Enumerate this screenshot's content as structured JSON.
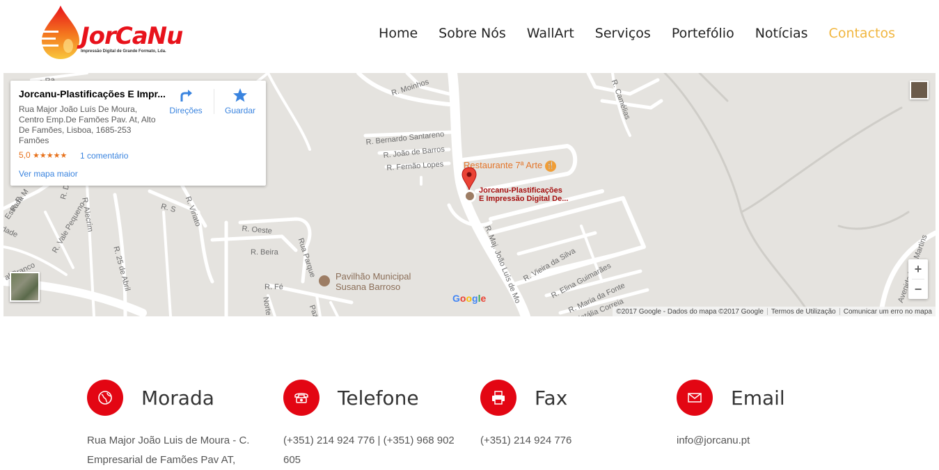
{
  "header": {
    "logo_name": "JorCaNu",
    "logo_tagline": "Impressão Digital de Grande Formato, Lda.",
    "nav": [
      "Home",
      "Sobre Nós",
      "WallArt",
      "Serviços",
      "Portefólio",
      "Notícias",
      "Contactos"
    ],
    "active_nav": "Contactos",
    "accent_color": "#f1b63f"
  },
  "map": {
    "info_card": {
      "title": "Jorcanu-Plastificações E Impr...",
      "address": "Rua Major João Luís De Moura, Centro Emp.De Famões Pav. At, Alto De Famões, Lisboa, 1685-253 Famões",
      "rating": "5,0",
      "stars": "★★★★★",
      "reviews": "1 comentário",
      "directions": "Direções",
      "save": "Guardar",
      "larger_map": "Ver mapa maior"
    },
    "marker_label_1": "Jorcanu-Plastificações",
    "marker_label_2": "E Impressão Digital De...",
    "poi_restaurant": "Restaurante 7ª Arte",
    "poi_pavilion_1": "Pavilhão Municipal",
    "poi_pavilion_2": "Susana Barroso",
    "streets": {
      "moinhos": "R. Moinhos",
      "camelias": "R. Camélias",
      "bernardo": "R. Bernardo Santareno",
      "joao_barros": "R. João de Barros",
      "fernao": "R. Fernão Lopes",
      "oeste": "R. Oeste",
      "beira": "R. Beira",
      "fe": "R. Fé",
      "viriato": "R. Viriato",
      "s": "R. S",
      "d": "R. D",
      "vale_pequeno": "R. Vale Pequeno",
      "alecrim": "R. Alecrim",
      "25_abril": "R. 25 de Abril",
      "parque": "Rua Parque",
      "maj_joao": "R. Maj. João Luís de Mo",
      "vieira": "R. Vieira da Silva",
      "elina": "R. Elina Guimarães",
      "maria_fonte": "R. Maria da Fonte",
      "natalia": "Natália Correia",
      "pais_martins": "Avenida Pais Martins",
      "estrada": "Estrada M",
      "branco": "al Branco",
      "dade": "dade",
      "norte": "Norte",
      "paz": "Paz",
      "ra": "e Ra",
      "r": "R. R"
    },
    "google": "Google",
    "attribution": "©2017 Google - Dados do mapa ©2017 Google",
    "terms": "Termos de Utilização",
    "report": "Comunicar um erro no mapa",
    "zoom_in": "+",
    "zoom_out": "−"
  },
  "contact": {
    "address_title": "Morada",
    "address_text": "Rua Major João Luis de Moura - C. Empresarial de Famões Pav AT,",
    "phone_title": "Telefone",
    "phone_text": "(+351) 214 924 776 | (+351) 968 902 605",
    "fax_title": "Fax",
    "fax_text": "(+351) 214 924 776",
    "email_title": "Email",
    "email_text": "info@jorcanu.pt",
    "circle_color": "#e30613"
  }
}
